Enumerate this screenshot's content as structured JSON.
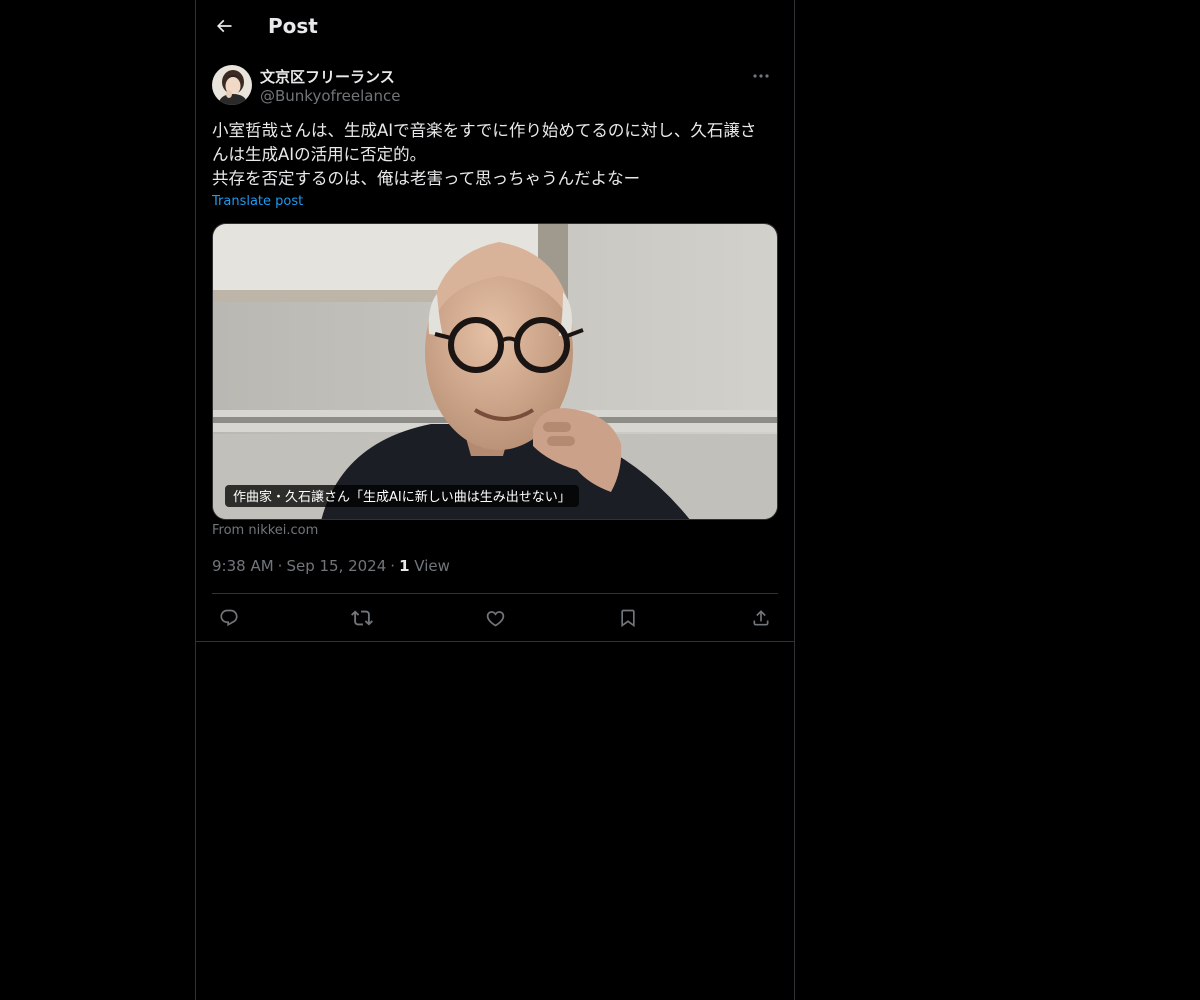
{
  "header": {
    "title": "Post",
    "back_icon": "arrow-left-icon"
  },
  "post": {
    "author": {
      "display_name": "文京区フリーランス",
      "handle": "@Bunkyofreelance"
    },
    "text_lines": [
      "小室哲哉さんは、生成AIで音楽をすでに作り始めてるのに対し、久石譲さ",
      "んは生成AIの活用に否定的。",
      "共存を否定するのは、俺は老害って思っちゃうんだよなー"
    ],
    "translate_label": "Translate post",
    "media": {
      "caption": "作曲家・久石譲さん「生成AIに新しい曲は生み出せない」",
      "source": "From nikkei.com"
    },
    "time": "9:38 AM",
    "date": "Sep 15, 2024",
    "separator": "·",
    "views_count": "1",
    "views_label": "View"
  },
  "actions": [
    {
      "name": "reply",
      "icon": "reply-icon"
    },
    {
      "name": "repost",
      "icon": "repost-icon"
    },
    {
      "name": "like",
      "icon": "heart-icon"
    },
    {
      "name": "bookmark",
      "icon": "bookmark-icon"
    },
    {
      "name": "share",
      "icon": "share-icon"
    }
  ],
  "colors": {
    "background": "#000000",
    "text": "#e7e9ea",
    "secondary_text": "#71767b",
    "accent": "#1d9bf0",
    "border": "#2f3336"
  }
}
